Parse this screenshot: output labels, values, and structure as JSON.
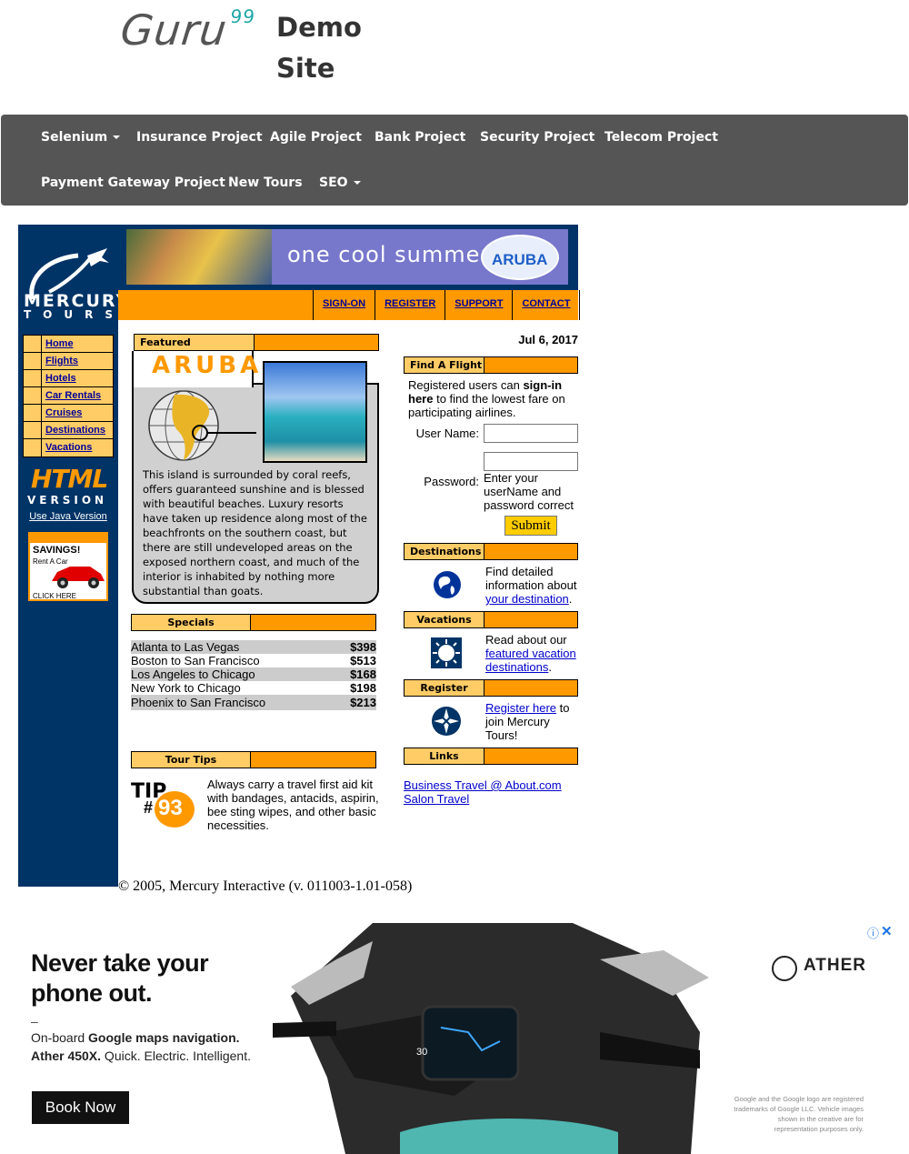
{
  "header": {
    "logo_text": "Guru",
    "logo_sup": "99",
    "demo_line1": "Demo",
    "demo_line2": "Site"
  },
  "nav": {
    "row1": [
      {
        "label": "Selenium",
        "dropdown": true
      },
      {
        "label": "Insurance Project",
        "dropdown": false
      },
      {
        "label": "Agile Project",
        "dropdown": false
      },
      {
        "label": "Bank Project",
        "dropdown": false
      },
      {
        "label": "Security Project",
        "dropdown": false
      },
      {
        "label": "Telecom Project",
        "dropdown": false
      }
    ],
    "row2": [
      {
        "label": "Payment Gateway Project",
        "dropdown": false
      },
      {
        "label": "New Tours",
        "dropdown": false
      },
      {
        "label": "SEO",
        "dropdown": true
      }
    ]
  },
  "mercury": {
    "brand_top": "MERCURY",
    "brand_bottom": "TOURS",
    "left_menu": [
      "Home",
      "Flights",
      "Hotels",
      "Car Rentals",
      "Cruises",
      "Destinations",
      "Vacations"
    ],
    "html_version_line1": "HTML",
    "html_version_line2": "VERSION",
    "java_link": "Use Java Version",
    "savings_ad": {
      "title": "SAVINGS!",
      "sub": "Rent A Car",
      "cta": "CLICK HERE"
    }
  },
  "banner": {
    "text": "one cool summer",
    "badge": "ARUBA"
  },
  "top_links": [
    "SIGN-ON",
    "REGISTER",
    "SUPPORT",
    "CONTACT"
  ],
  "featured": {
    "header": "Featured Destination",
    "name": "ARUBA",
    "description": "This island is surrounded by coral reefs, offers guaranteed sunshine and is blessed with beautiful beaches. Luxury resorts have taken up residence along most of the beachfronts on the southern coast, but there are still undeveloped areas on the exposed northern coast, and much of the interior is inhabited by nothing more substantial than goats."
  },
  "specials": {
    "header": "Specials",
    "rows": [
      {
        "route": "Atlanta to Las Vegas",
        "price": "$398"
      },
      {
        "route": "Boston to San Francisco",
        "price": "$513"
      },
      {
        "route": "Los Angeles to Chicago",
        "price": "$168"
      },
      {
        "route": "New York to Chicago",
        "price": "$198"
      },
      {
        "route": "Phoenix to San Francisco",
        "price": "$213"
      }
    ]
  },
  "tour_tips": {
    "header": "Tour Tips",
    "tip_word": "TIP",
    "tip_hash": "#",
    "tip_number": "93",
    "text": "Always carry a travel first aid kit with bandages, antacids, aspirin, bee sting wipes, and other basic necessities."
  },
  "date": "Jul 6, 2017",
  "find_flight": {
    "header": "Find A Flight",
    "intro_pre": "Registered users can ",
    "intro_bold": "sign-in here",
    "intro_post": " to find the lowest fare on participating airlines.",
    "username_label": "User Name:",
    "password_label": "Password:",
    "username_value": "",
    "password_value": "",
    "help": "Enter your userName and password correct",
    "submit": "Submit"
  },
  "destinations": {
    "header": "Destinations",
    "text_pre": "Find detailed information about ",
    "link": "your destination",
    "text_post": "."
  },
  "vacations": {
    "header": "Vacations",
    "text_pre": "Read about our ",
    "link": "featured vacation destinations",
    "text_post": "."
  },
  "register": {
    "header": "Register",
    "link": "Register here",
    "text_post": " to join Mercury Tours!"
  },
  "links": {
    "header": "Links",
    "items": [
      "Business Travel @ About.com",
      "Salon Travel"
    ]
  },
  "copyright": "© 2005, Mercury Interactive (v. 011003-1.01-058)",
  "ad": {
    "headline": "Never take your phone out.",
    "dash": "–",
    "sub_pre": "On-board ",
    "sub_bold": "Google maps navigation.",
    "sub_line2_bold": "Ather 450X.",
    "sub_line2_rest": " Quick. Electric. Intelligent.",
    "button": "Book Now",
    "brand": "ATHER",
    "fine_print": "Google and the Google logo are registered trademarks of Google LLC. Vehicle images shown in the creative are for representation purposes only.",
    "info_icon": "ⓘ",
    "close_icon": "✕",
    "dash_speed": "30"
  }
}
